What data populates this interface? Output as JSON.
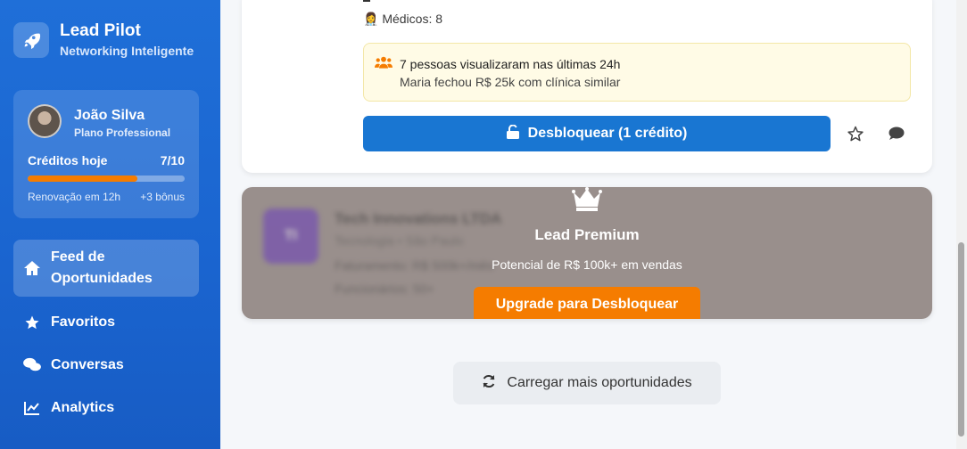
{
  "app": {
    "name": "Lead Pilot",
    "tagline": "Networking Inteligente"
  },
  "user": {
    "name": "João Silva",
    "plan": "Plano Professional",
    "credits_label": "Créditos hoje",
    "credits_value": "7/10",
    "credits_progress": 0.7,
    "renewal": "Renovação em 12h",
    "bonus": "+3 bônus"
  },
  "nav": [
    {
      "label": "Feed de Oportunidades",
      "icon": "home-icon",
      "active": true
    },
    {
      "label": "Favoritos",
      "icon": "star-icon",
      "active": false
    },
    {
      "label": "Conversas",
      "icon": "chat-icon",
      "active": false
    },
    {
      "label": "Analytics",
      "icon": "chart-icon",
      "active": false
    }
  ],
  "lead_card": {
    "medicos": "👩‍⚕️ Médicos: 8",
    "alert_line1": "7 pessoas visualizaram nas últimas 24h",
    "alert_line2": "Maria fechou R$ 25k com clínica similar",
    "unlock_label": "Desbloquear (1 crédito)"
  },
  "premium_card": {
    "blurred": {
      "logo_initials": "TI",
      "title": "Tech Innovations LTDA",
      "subtitle": "Tecnologia • São Paulo",
      "line1": "Faturamento: R$ 500k+/mês",
      "line2": "Funcionários: 50+"
    },
    "title": "Lead Premium",
    "subtitle": "Potencial de R$ 100k+ em vendas",
    "upgrade_label": "Upgrade para Desbloquear"
  },
  "load_more_label": "Carregar mais oportunidades",
  "colors": {
    "primary": "#1976d2",
    "accent": "#f57c00",
    "sidebar": "#1a64cf"
  }
}
